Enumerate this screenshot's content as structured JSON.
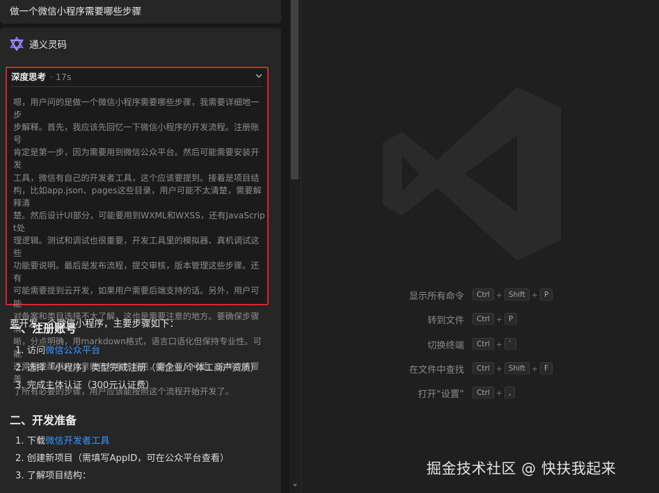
{
  "chat": {
    "user_question": "做一个微信小程序需要哪些步骤",
    "assistant_name": "通义灵码",
    "thinking": {
      "title": "深度思考",
      "duration": "· 17s",
      "lines": [
        "嗯，用户问的是做一个微信小程序需要哪些步骤，我需要详细地一步",
        "步解释。首先，我应该先回忆一下微信小程序的开发流程。注册账号",
        "肯定是第一步，因为需要用到微信公众平台。然后可能需要安装开发",
        "工具，微信有自己的开发者工具，这个应该要提到。接着是项目结",
        "构，比如app.json、pages这些目录，用户可能不太清楚，需要解释清",
        "楚。然后设计UI部分，可能要用到WXML和WXSS，还有JavaScript处",
        "理逻辑。测试和调试也很重要，开发工具里的模拟器、真机调试这些",
        "功能要说明。最后是发布流程，提交审核，版本管理这些步骤。还有",
        "可能需要提到云开发，如果用户需要后端支持的话。另外，用户可能",
        "对备案和类目选择不太了解，这也是需要注意的地方。要确保步骤清",
        "晰，分点明确，用markdown格式，语言口语化但保持专业性。可能",
        "还需要提醒用户注意微信的审核规范，避免常见问题。这样应该覆盖",
        "了所有必要的步骤，用户应该能按照这个流程开始开发了。"
      ]
    },
    "answer_intro": "要开发一个微信小程序，主要步骤如下：",
    "section1": {
      "heading": "一、注册账号",
      "items": [
        {
          "prefix": "1. 访问",
          "link": "微信公众平台",
          "suffix": ""
        },
        {
          "prefix": "2. 选择「小程序」类型完成注册（需企业/个体工商户资质）",
          "link": "",
          "suffix": ""
        },
        {
          "prefix": "3. 完成主体认证（300元认证费）",
          "link": "",
          "suffix": ""
        }
      ]
    },
    "section2": {
      "heading": "二、开发准备",
      "items": [
        {
          "prefix": "1. 下载",
          "link": "微信开发者工具",
          "suffix": ""
        },
        {
          "prefix": "2. 创建新项目（需填写AppID，可在公众平台查看）",
          "link": "",
          "suffix": ""
        },
        {
          "prefix": "3. 了解项目结构：",
          "link": "",
          "suffix": ""
        }
      ]
    }
  },
  "welcome": {
    "shortcuts": [
      {
        "label": "显示所有命令",
        "keys": [
          "Ctrl",
          "Shift",
          "P"
        ]
      },
      {
        "label": "转到文件",
        "keys": [
          "Ctrl",
          "P"
        ]
      },
      {
        "label": "切换终端",
        "keys": [
          "Ctrl",
          "`"
        ]
      },
      {
        "label": "在文件中查找",
        "keys": [
          "Ctrl",
          "Shift",
          "F"
        ]
      },
      {
        "label": "打开“设置”",
        "keys": [
          "Ctrl",
          ","
        ]
      }
    ]
  },
  "watermark": "掘金技术社区 @ 快扶我起来",
  "colors": {
    "highlight_border": "#d8262b",
    "link": "#3794ff",
    "panel_bg": "#262626",
    "editor_bg": "#1f1f1f"
  },
  "icons": {
    "assistant_logo": "tongyi-lingma-logo",
    "collapse": "chevron-down-icon",
    "background": "vscode-logo-watermark"
  }
}
